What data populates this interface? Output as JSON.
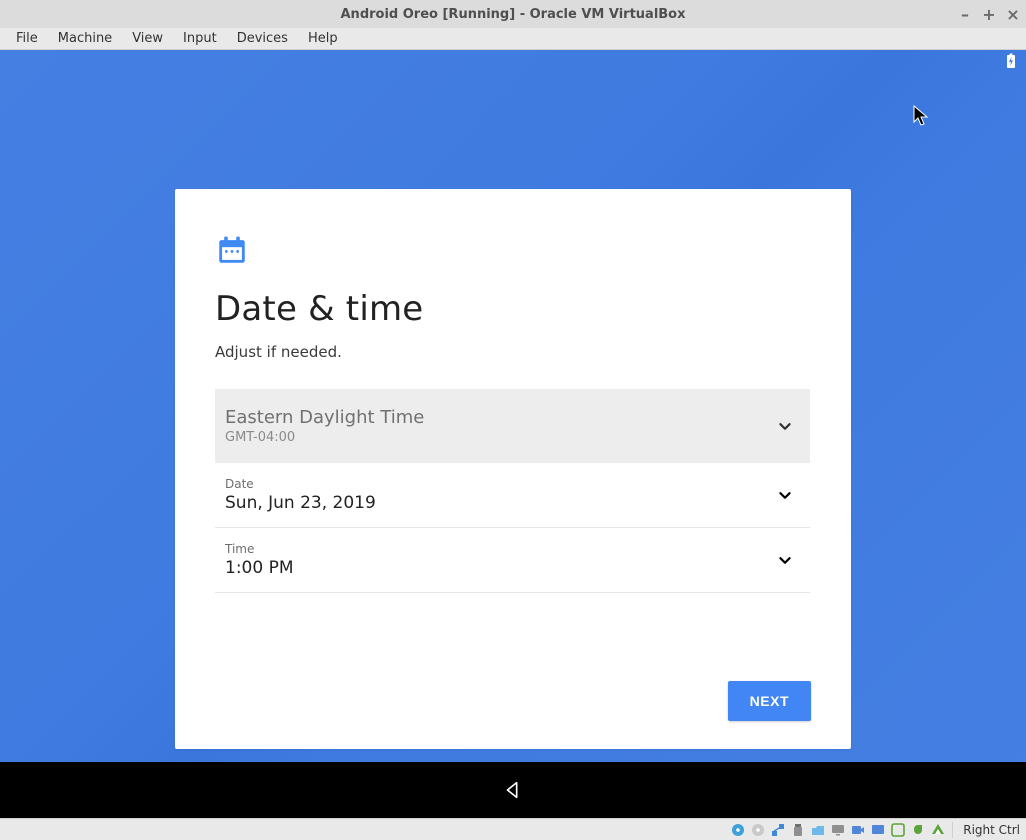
{
  "window": {
    "title": "Android Oreo [Running] - Oracle VM VirtualBox",
    "controls": {
      "minimize": "–",
      "maximize": "+",
      "close": "×"
    }
  },
  "menubar": {
    "items": [
      "File",
      "Machine",
      "View",
      "Input",
      "Devices",
      "Help"
    ]
  },
  "setup": {
    "title": "Date & time",
    "subtitle": "Adjust if needed.",
    "timezone": {
      "name": "Eastern Daylight Time",
      "offset": "GMT-04:00"
    },
    "date": {
      "label": "Date",
      "value": "Sun, Jun 23, 2019"
    },
    "time": {
      "label": "Time",
      "value": "1:00 PM"
    },
    "next_label": "NEXT"
  },
  "vb_status": {
    "host_key": "Right Ctrl"
  }
}
